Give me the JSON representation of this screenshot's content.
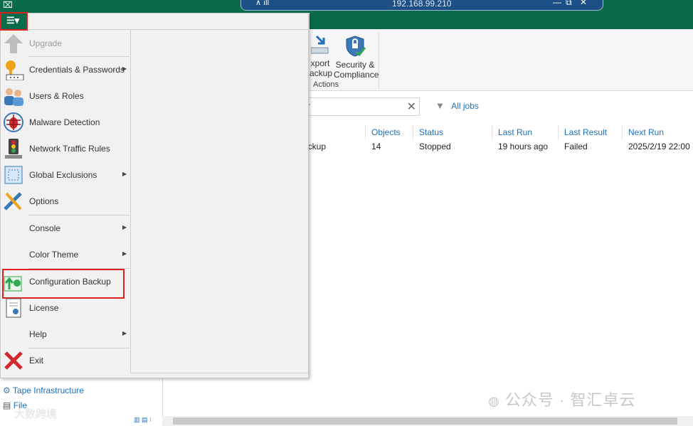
{
  "remote_bar": {
    "host": "192.168.99.210"
  },
  "ribbon": {
    "export_label_1": "xport",
    "export_label_2": "ackup",
    "security_label_1": "Security &",
    "security_label_2": "Compliance",
    "group_label": "Actions"
  },
  "search": {
    "value": "r"
  },
  "filter": {
    "label": "All jobs"
  },
  "table": {
    "headers": [
      "Objects",
      "Status",
      "Last Run",
      "Last Result",
      "Next Run"
    ],
    "row": {
      "name": "ackup",
      "objects": "14",
      "status": "Stopped",
      "last_run": "19 hours ago",
      "last_result": "Failed",
      "next_run": "2025/2/19 22:00"
    }
  },
  "menu": {
    "items": [
      {
        "label": "Upgrade",
        "icon": "upgrade-arrow-icon",
        "disabled": true
      },
      {
        "label": "Credentials & Passwords",
        "icon": "key-icon",
        "submenu": true
      },
      {
        "label": "Users & Roles",
        "icon": "users-icon"
      },
      {
        "label": "Malware Detection",
        "icon": "bug-icon"
      },
      {
        "label": "Network Traffic Rules",
        "icon": "traffic-light-icon"
      },
      {
        "label": "Global Exclusions",
        "icon": "exclusions-icon",
        "submenu": true
      },
      {
        "label": "Options",
        "icon": "wrench-icon"
      },
      {
        "label": "Console",
        "submenu": true
      },
      {
        "label": "Color Theme",
        "submenu": true
      },
      {
        "label": "Configuration Backup",
        "icon": "config-backup-icon"
      },
      {
        "label": "License",
        "icon": "license-icon"
      },
      {
        "label": "Help",
        "submenu": true
      },
      {
        "label": "Exit",
        "icon": "exit-x-icon"
      }
    ]
  },
  "nav": {
    "tape_infrastructure": "Tape Infrastructure",
    "files": "File"
  },
  "watermark": {
    "text": "公众号 · 智汇卓云",
    "overlay": "大数跨境"
  },
  "colors": {
    "brand_green": "#0a6b4a",
    "highlight_red": "#e02020",
    "link_blue": "#1f6fb8"
  }
}
